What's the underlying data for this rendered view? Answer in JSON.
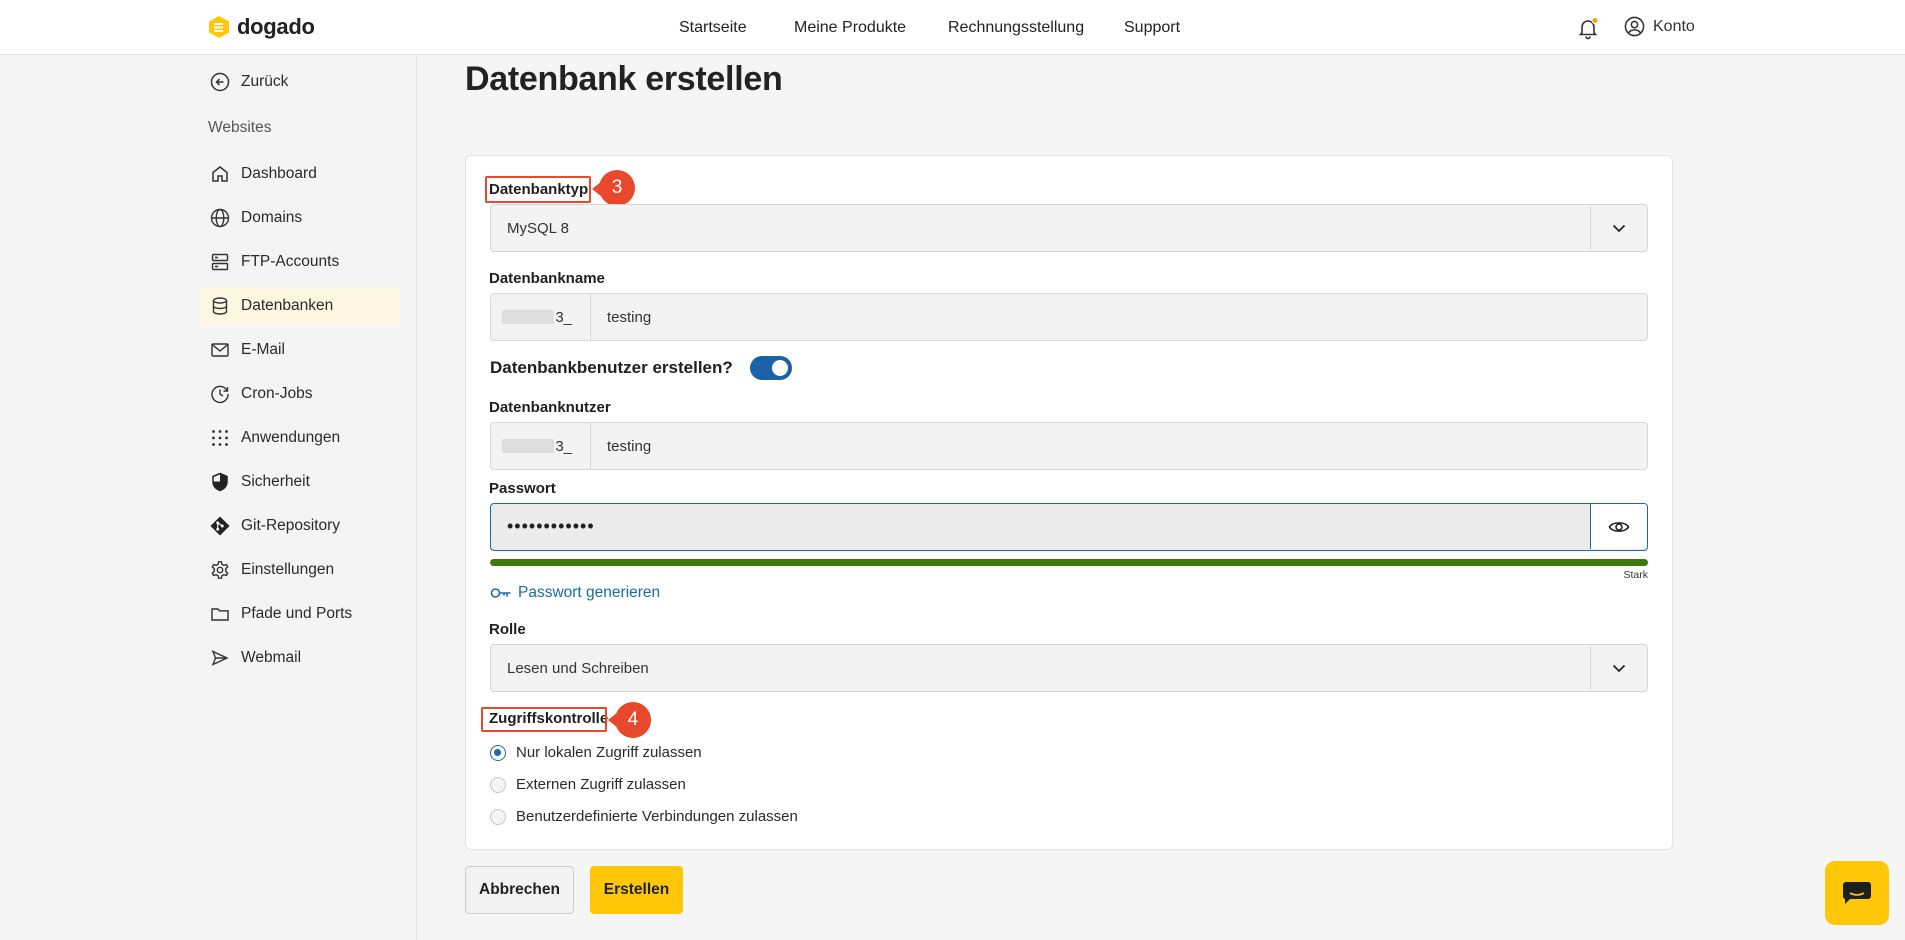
{
  "brand": {
    "name": "dogado",
    "accent": "#ffc708"
  },
  "nav": {
    "items": [
      "Startseite",
      "Meine Produkte",
      "Rechnungsstellung",
      "Support"
    ]
  },
  "account": {
    "label": "Konto"
  },
  "sidebar": {
    "back": "Zurück",
    "section": "Websites",
    "items": [
      {
        "label": "Dashboard",
        "icon": "home-icon"
      },
      {
        "label": "Domains",
        "icon": "globe-icon"
      },
      {
        "label": "FTP-Accounts",
        "icon": "server-icon"
      },
      {
        "label": "Datenbanken",
        "icon": "database-icon",
        "active": true
      },
      {
        "label": "E-Mail",
        "icon": "mail-icon"
      },
      {
        "label": "Cron-Jobs",
        "icon": "clock-icon"
      },
      {
        "label": "Anwendungen",
        "icon": "grid-icon"
      },
      {
        "label": "Sicherheit",
        "icon": "shield-icon"
      },
      {
        "label": "Git-Repository",
        "icon": "git-icon"
      },
      {
        "label": "Einstellungen",
        "icon": "gear-icon"
      },
      {
        "label": "Pfade und Ports",
        "icon": "folder-icon"
      },
      {
        "label": "Webmail",
        "icon": "send-icon"
      }
    ]
  },
  "page": {
    "title": "Datenbank erstellen"
  },
  "form": {
    "db_type": {
      "label": "Datenbanktyp",
      "value": "MySQL 8"
    },
    "db_name": {
      "label": "Datenbankname",
      "prefix": "3_",
      "value": "testing"
    },
    "create_user": {
      "label": "Datenbankbenutzer erstellen?",
      "enabled": true
    },
    "db_user": {
      "label": "Datenbanknutzer",
      "prefix": "3_",
      "value": "testing"
    },
    "password": {
      "label": "Passwort",
      "value": "••••••••••••",
      "strength_label": "Stark",
      "strength": 1.0
    },
    "generate_link": "Passwort generieren",
    "role": {
      "label": "Rolle",
      "value": "Lesen und Schreiben"
    },
    "access": {
      "label": "Zugriffskontrolle",
      "options": [
        {
          "label": "Nur lokalen Zugriff zulassen",
          "selected": true
        },
        {
          "label": "Externen Zugriff zulassen",
          "selected": false
        },
        {
          "label": "Benutzerdefinierte Verbindungen zulassen",
          "selected": false
        }
      ]
    }
  },
  "annotations": {
    "first": "3",
    "second": "4",
    "color": "#e8492a"
  },
  "buttons": {
    "cancel": "Abbrechen",
    "create": "Erstellen"
  }
}
